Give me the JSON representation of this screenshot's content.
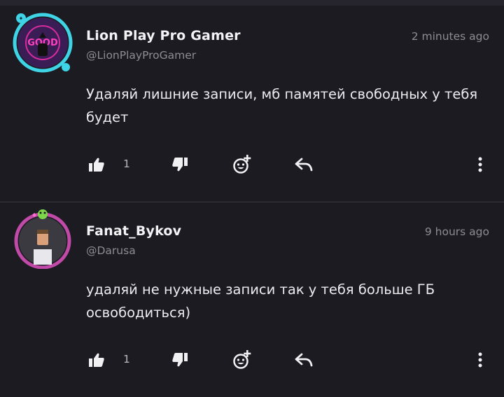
{
  "comments": [
    {
      "author": "Lion Play Pro Gamer",
      "handle": "@LionPlayProGamer",
      "time": "2 minutes ago",
      "text": "Удаляй лишние записи, мб памятей свободных у тебя будет",
      "likes": "1",
      "avatar_ring_color": "#3fd3e6",
      "avatar_text": "GOOD"
    },
    {
      "author": "Fanat_Bykov",
      "handle": "@Darusa",
      "time": "9 hours ago",
      "text": "удаляй не нужные записи так у тебя больше ГБ освободиться)",
      "likes": "1",
      "avatar_ring_color": "#c14aa8"
    }
  ],
  "icons": {
    "like": "thumbs-up-icon",
    "dislike": "thumbs-down-icon",
    "react": "add-emoji-icon",
    "reply": "reply-arrow-icon",
    "more": "more-vertical-icon"
  }
}
